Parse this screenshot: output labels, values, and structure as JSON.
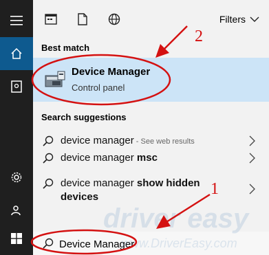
{
  "toolbar": {
    "filters_label": "Filters"
  },
  "best_match": {
    "section_title": "Best match",
    "title": "Device Manager",
    "subtitle": "Control panel"
  },
  "suggestions": {
    "section_title": "Search suggestions",
    "items": [
      {
        "text": "device manager",
        "bold": "",
        "hint": " - See web results"
      },
      {
        "text": "device manager ",
        "bold": "msc",
        "hint": ""
      },
      {
        "text": "device manager ",
        "bold": "show hidden devices",
        "hint": ""
      }
    ]
  },
  "search": {
    "value": "Device Manager"
  },
  "annotations": {
    "label_1": "1",
    "label_2": "2",
    "color": "#d41111"
  },
  "watermark": {
    "brand": "driver easy",
    "url": "www.DriverEasy.com"
  },
  "colors": {
    "rail": "#1f1f1f",
    "rail_active": "#0e5a8f",
    "highlight": "#cce4f7"
  }
}
